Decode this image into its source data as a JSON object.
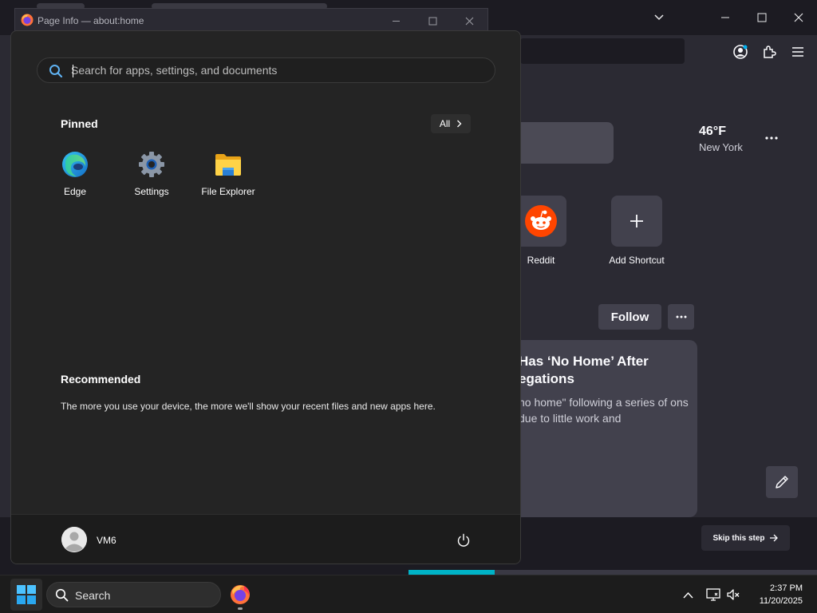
{
  "browser": {
    "toolbar_icons": [
      "account-icon",
      "extensions-icon",
      "menu-icon"
    ],
    "weather": {
      "temperature": "46°F",
      "city": "New York"
    },
    "shortcuts": [
      {
        "label": "Reddit",
        "icon": "reddit-icon"
      },
      {
        "label": "Add Shortcut",
        "icon": "plus-icon"
      }
    ],
    "follow_label": "Follow",
    "story": {
      "title": "Has ‘No Home’ After egations",
      "text": "no home\" following a series of ons due to little work and"
    },
    "skip_label": "Skip this step",
    "onboarding_progress": 0.21,
    "colors": {
      "accent": "#00b3c7",
      "panel": "#2b2a33",
      "card": "#42414d"
    }
  },
  "page_info": {
    "title": "Page Info — about:home"
  },
  "start_menu": {
    "search_placeholder": "Search for apps, settings, and documents",
    "pinned_title": "Pinned",
    "all_label": "All",
    "pinned_apps": [
      {
        "label": "Edge",
        "icon": "edge-icon"
      },
      {
        "label": "Settings",
        "icon": "settings-gear-icon"
      },
      {
        "label": "File Explorer",
        "icon": "folder-icon"
      }
    ],
    "recommended_title": "Recommended",
    "recommended_text": "The more you use your device, the more we'll show your recent files and new apps here.",
    "user_name": "VM6"
  },
  "taskbar": {
    "search_label": "Search",
    "time": "2:37 PM",
    "date": "11/20/2025"
  }
}
